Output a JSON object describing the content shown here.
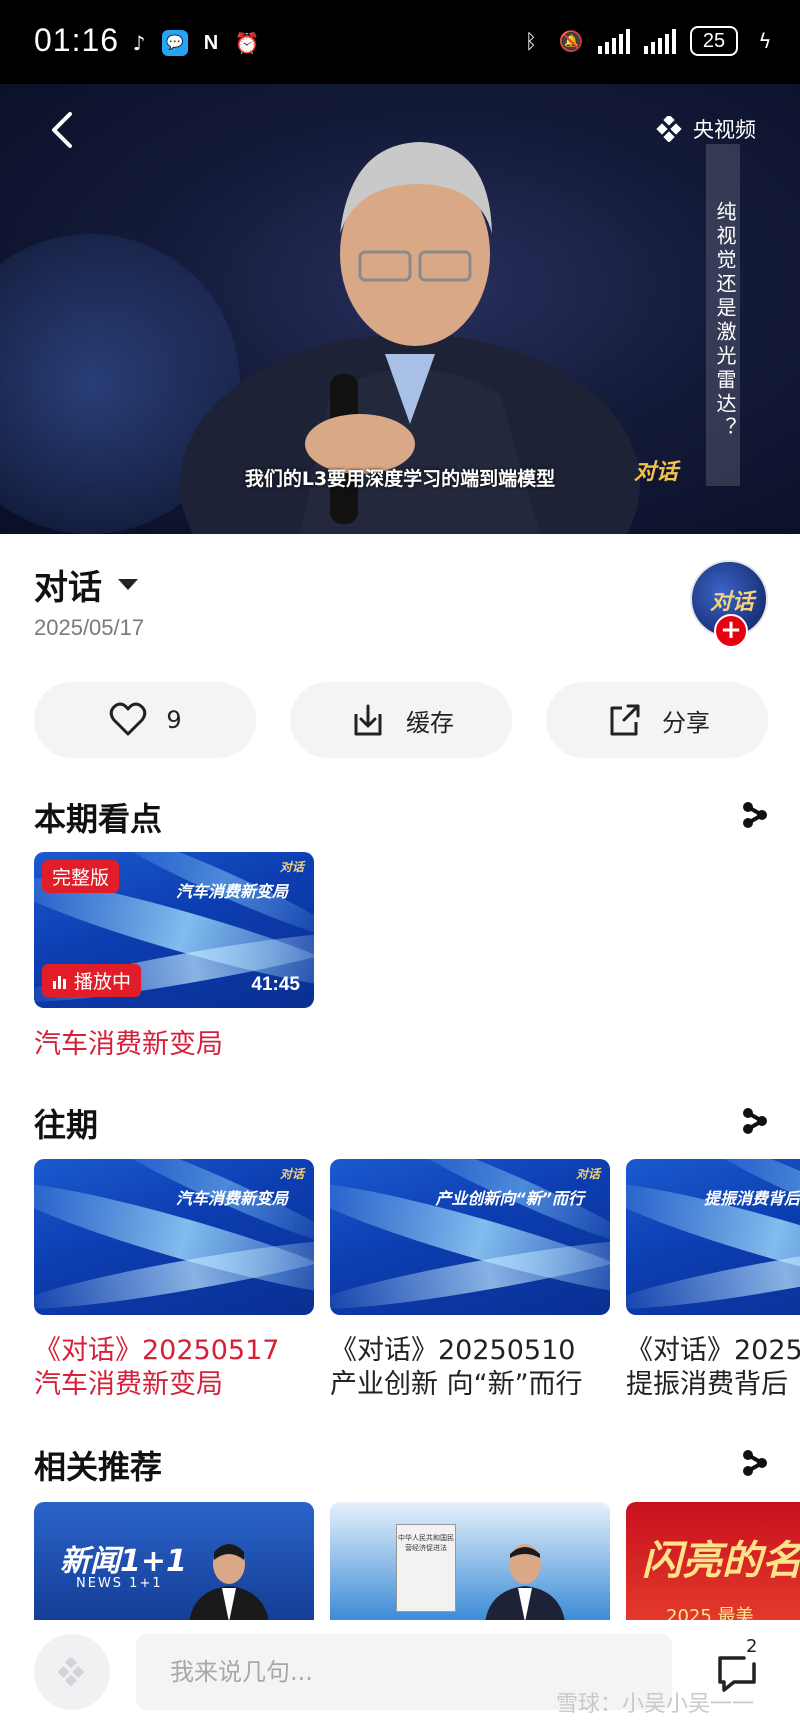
{
  "status_bar": {
    "time": "01:16",
    "battery": "25"
  },
  "video": {
    "channel_logo": "央视频",
    "vertical_title": "纯视觉还是激光雷达？",
    "subtitle": "我们的L3要用深度学习的端到端模型",
    "corner_logo": "对话"
  },
  "program": {
    "title": "对话",
    "date": "2025/05/17",
    "avatar_text": "对话"
  },
  "actions": {
    "like_count": "9",
    "cache_label": "缓存",
    "share_label": "分享"
  },
  "highlights": {
    "heading": "本期看点",
    "item": {
      "badge_full": "完整版",
      "badge_playing": "播放中",
      "thumb_caption": "汽车消费新变局",
      "duration": "41:45",
      "title": "汽车消费新变局"
    }
  },
  "past": {
    "heading": "往期",
    "items": [
      {
        "thumb_caption": "汽车消费新变局",
        "line1": "《对话》20250517",
        "line2": "汽车消费新变局"
      },
      {
        "thumb_caption": "产业创新向“新”而行",
        "line1": "《对话》20250510",
        "line2": "产业创新 向“新”而行"
      },
      {
        "thumb_caption": "提振消费背后",
        "line1": "《对话》2025",
        "line2": "提振消费背后"
      }
    ]
  },
  "recommend": {
    "heading": "相关推荐",
    "items": [
      {
        "text": "新闻1+1",
        "sub": "NEWS 1+1"
      },
      {
        "text": "中华人民共和国民营经济促进法"
      },
      {
        "text": "闪亮的名",
        "sub": "2025 最美"
      }
    ]
  },
  "bottom_bar": {
    "comment_placeholder": "我来说几句...",
    "comment_count": "2",
    "watermark": "雪球：小吴小吴一一"
  }
}
